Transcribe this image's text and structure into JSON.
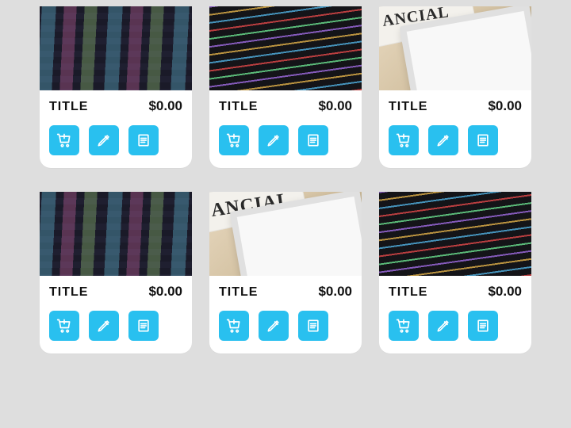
{
  "accent": "#29c0ef",
  "cards": [
    {
      "title": "TITLE",
      "price": "$0.00",
      "thumb": "code-dark"
    },
    {
      "title": "TITLE",
      "price": "$0.00",
      "thumb": "code-color"
    },
    {
      "title": "TITLE",
      "price": "$0.00",
      "thumb": "tablet"
    },
    {
      "title": "TITLE",
      "price": "$0.00",
      "thumb": "code-dark"
    },
    {
      "title": "TITLE",
      "price": "$0.00",
      "thumb": "tablet-zoom"
    },
    {
      "title": "TITLE",
      "price": "$0.00",
      "thumb": "code-color"
    }
  ],
  "newspaper_headline": "ANCIAL"
}
